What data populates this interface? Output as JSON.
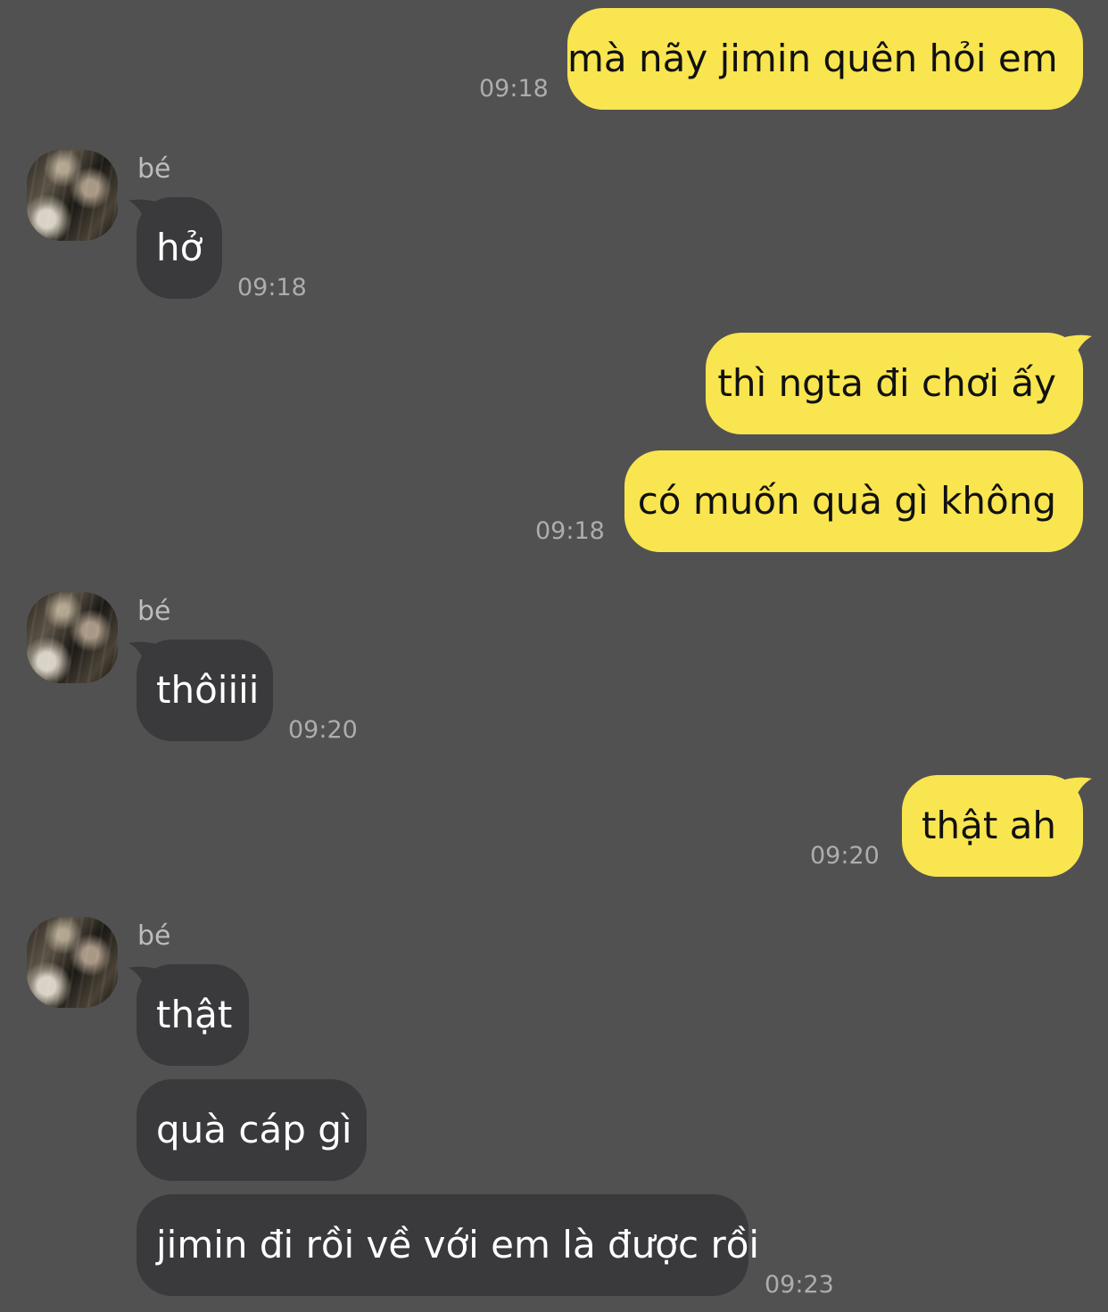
{
  "contact": {
    "name": "bé"
  },
  "messages": [
    {
      "sender": "me",
      "text": "mà nãy jimin quên hỏi em",
      "time": "09:18"
    },
    {
      "sender": "them",
      "text": "hở",
      "time": "09:18"
    },
    {
      "sender": "me",
      "text": "thì ngta đi chơi ấy",
      "time": ""
    },
    {
      "sender": "me",
      "text": "có muốn quà gì không",
      "time": "09:18"
    },
    {
      "sender": "them",
      "text": "thôiiii",
      "time": "09:20"
    },
    {
      "sender": "me",
      "text": "thật ah",
      "time": "09:20"
    },
    {
      "sender": "them",
      "text": "thật",
      "time": ""
    },
    {
      "sender": "them",
      "text": "quà cáp gì",
      "time": ""
    },
    {
      "sender": "them",
      "text": "jimin đi rồi về với em là được rồi",
      "time": "09:23"
    }
  ],
  "colors": {
    "background": "#525152",
    "my_bubble": "#f9e54f",
    "their_bubble": "#3a393c",
    "timestamp": "#adadad"
  }
}
